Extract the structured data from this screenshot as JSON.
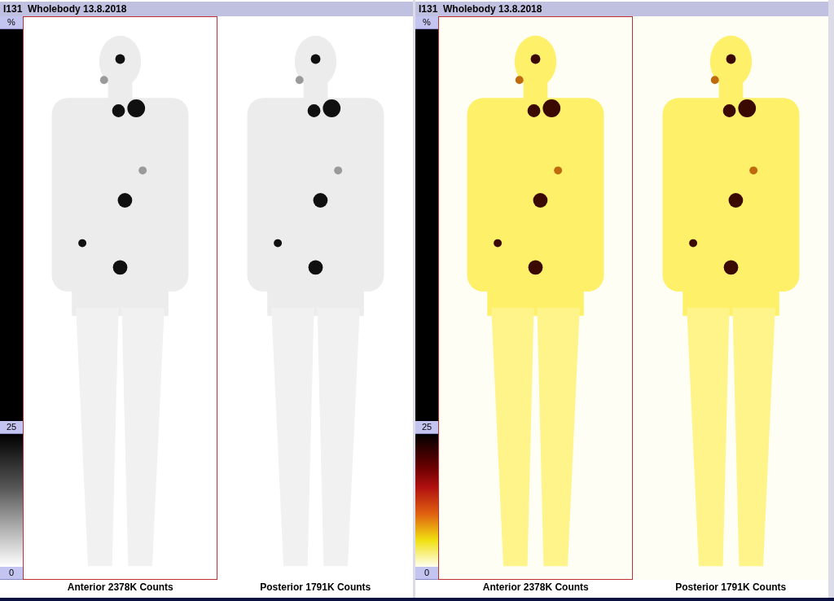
{
  "panels": [
    {
      "title": "I131  Wholebody 13.8.2018",
      "kind": "gray",
      "scale": {
        "unit": "%",
        "upper": "25",
        "lower": "0"
      },
      "views": [
        {
          "label": "Anterior 2378K Counts",
          "selected": true
        },
        {
          "label": "Posterior 1791K Counts",
          "selected": false
        }
      ]
    },
    {
      "title": "I131  Wholebody 13.8.2018",
      "kind": "hot",
      "scale": {
        "unit": "%",
        "upper": "25",
        "lower": "0"
      },
      "views": [
        {
          "label": "Anterior 2378K Counts",
          "selected": true
        },
        {
          "label": "Posterior 1791K Counts",
          "selected": false
        }
      ]
    }
  ]
}
